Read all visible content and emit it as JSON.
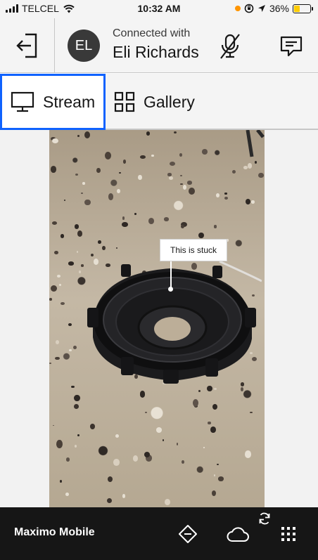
{
  "status_bar": {
    "carrier": "TELCEL",
    "time": "10:32 AM",
    "battery": "36%",
    "battery_fraction": 0.36,
    "battery_color": "#ffcc00"
  },
  "header": {
    "avatar_initials": "EL",
    "connected_label": "Connected with",
    "contact_name": "Eli Richards",
    "icons": [
      "exit-icon",
      "mic-off-icon",
      "chat-icon"
    ]
  },
  "tabs": [
    {
      "label": "Stream",
      "icon": "monitor-icon",
      "selected": true
    },
    {
      "label": "Gallery",
      "icon": "grid-icon",
      "selected": false
    }
  ],
  "video": {
    "annotation_text": "This is stuck"
  },
  "bottom_bar": {
    "app_name": "Maximo Mobile",
    "icons": [
      "navigation-icon",
      "cloud-sync-icon",
      "app-grid-icon"
    ]
  },
  "colors": {
    "accent": "#0f62fe",
    "bottom_bar": "#161616",
    "header_bg": "#f4f4f4"
  }
}
